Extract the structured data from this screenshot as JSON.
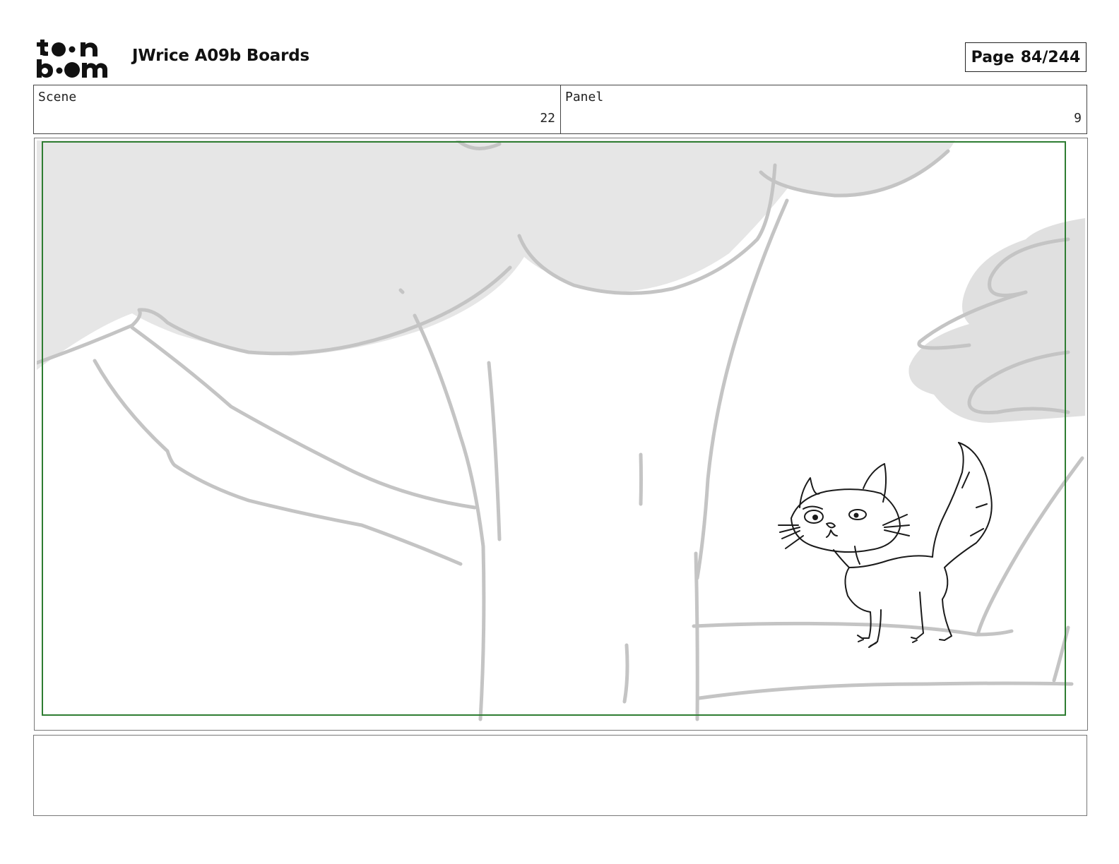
{
  "header": {
    "logo_alt": "toon boom",
    "title": "JWrice A09b Boards",
    "page_label": "Page",
    "page_number": "84/244"
  },
  "info": {
    "scene_label": "Scene",
    "scene_value": "22",
    "panel_label": "Panel",
    "panel_value": "9"
  },
  "notes": {
    "text": ""
  },
  "colors": {
    "safe_frame": "#2e7d32",
    "sketch_gray": "#c4c4c4",
    "foliage_fill": "#e6e6e6",
    "ink": "#1a1a1a"
  }
}
